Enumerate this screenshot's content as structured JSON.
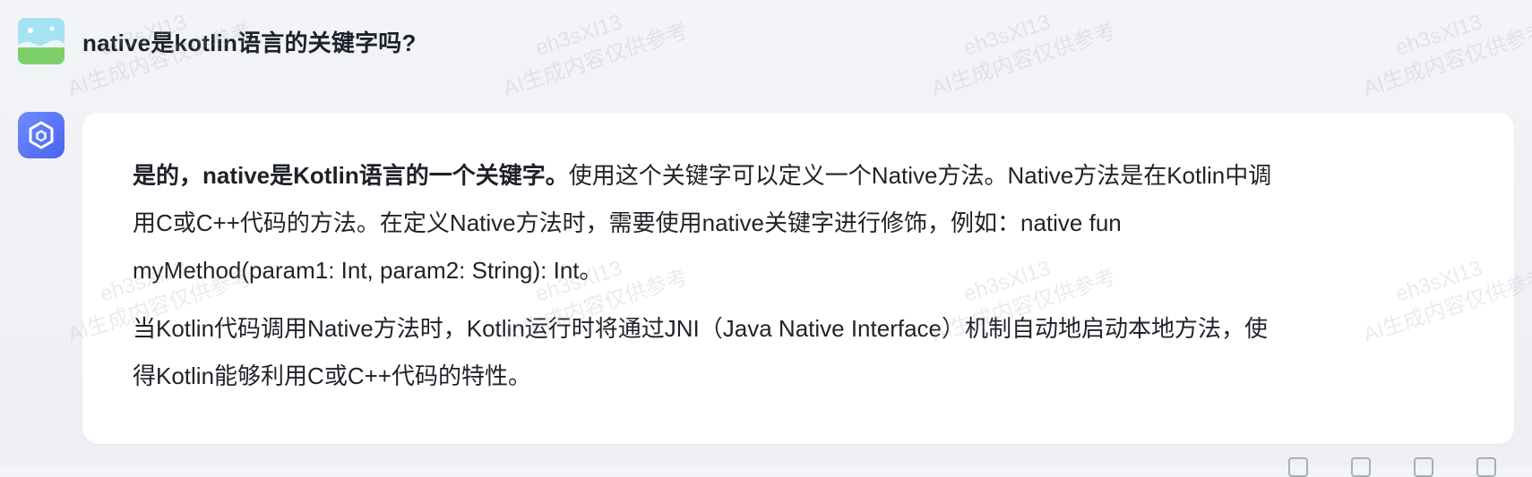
{
  "conversation": {
    "question": "native是kotlin语言的关键字吗?",
    "answer": {
      "p1_bold": "是的，native是Kotlin语言的一个关键字。",
      "p1_rest_line1": "使用这个关键字可以定义一个Native方法。Native方法是在Kotlin中调",
      "p1_line2": "用C或C++代码的方法。在定义Native方法时，需要使用native关键字进行修饰，例如：native fun",
      "p1_line3": "myMethod(param1: Int, param2: String): Int。",
      "p2_line1": "当Kotlin代码调用Native方法时，Kotlin运行时将通过JNI（Java Native Interface）机制自动地启动本地方法，使",
      "p2_line2": "得Kotlin能够利用C或C++代码的特性。"
    }
  },
  "watermark": {
    "id": "eh3sXl13",
    "text": "AI生成内容仅供参考"
  },
  "icons": {
    "user_avatar": "landscape-avatar-icon",
    "ai_avatar": "ai-logo-icon"
  },
  "colors": {
    "background": "#f3f4f7",
    "card": "#ffffff",
    "accent": "#4a63f0",
    "text": "#1f2329"
  }
}
